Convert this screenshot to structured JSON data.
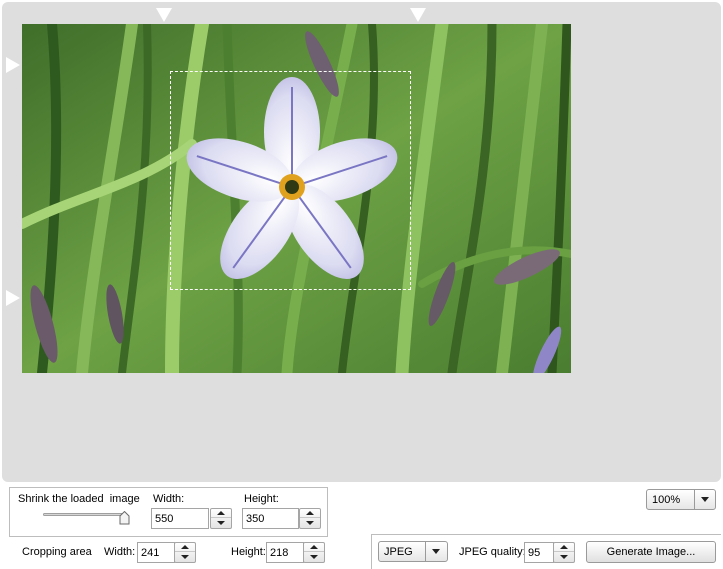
{
  "zoom": {
    "value": "100%"
  },
  "shrink": {
    "title": "Shrink the loaded  image",
    "slider_level": 1.0,
    "width_label": "Width:",
    "width_value": "550",
    "height_label": "Height:",
    "height_value": "350"
  },
  "cropping": {
    "title": "Cropping area",
    "width_label": "Width:",
    "width_value": "241",
    "height_label": "Height:",
    "height_value": "218"
  },
  "output": {
    "format": "JPEG",
    "quality_label": "JPEG quality:",
    "quality_value": "95",
    "generate_label": "Generate Image..."
  },
  "icons": {
    "zoom_arrow": "chevron-down-icon",
    "format_arrow": "chevron-down-icon",
    "spin_up": "arrow-up-icon",
    "spin_down": "arrow-down-icon"
  },
  "colors": {
    "workspace": "#dedede",
    "crop_border": "#ffffff"
  }
}
